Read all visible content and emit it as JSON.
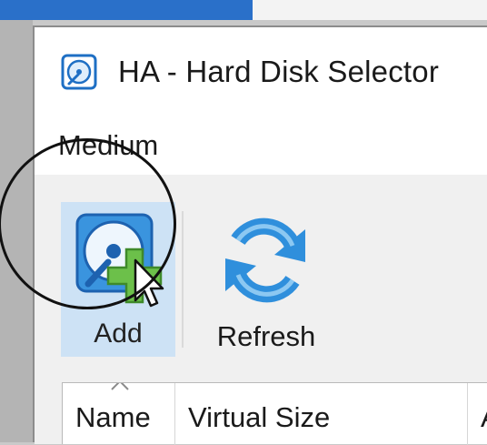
{
  "window": {
    "title": "HA - Hard Disk Selector",
    "icon": "hard-disk-icon"
  },
  "menu": {
    "items": [
      {
        "label": "Medium"
      }
    ]
  },
  "toolbar": {
    "add_label": "Add",
    "add_icon": "add-disk-icon",
    "refresh_label": "Refresh",
    "refresh_icon": "refresh-icon"
  },
  "table": {
    "columns": [
      {
        "label": "Name"
      },
      {
        "label": "Virtual Size"
      },
      {
        "label": "A"
      }
    ],
    "sort_indicator": "sort-ascending-icon"
  },
  "colors": {
    "title_bar_accent": "#2a70c9",
    "toolbar_background": "#f0f0f0",
    "add_highlight": "#cde2f5",
    "icon_blue": "#2f8fdc",
    "plus_green": "#6cc04a"
  }
}
